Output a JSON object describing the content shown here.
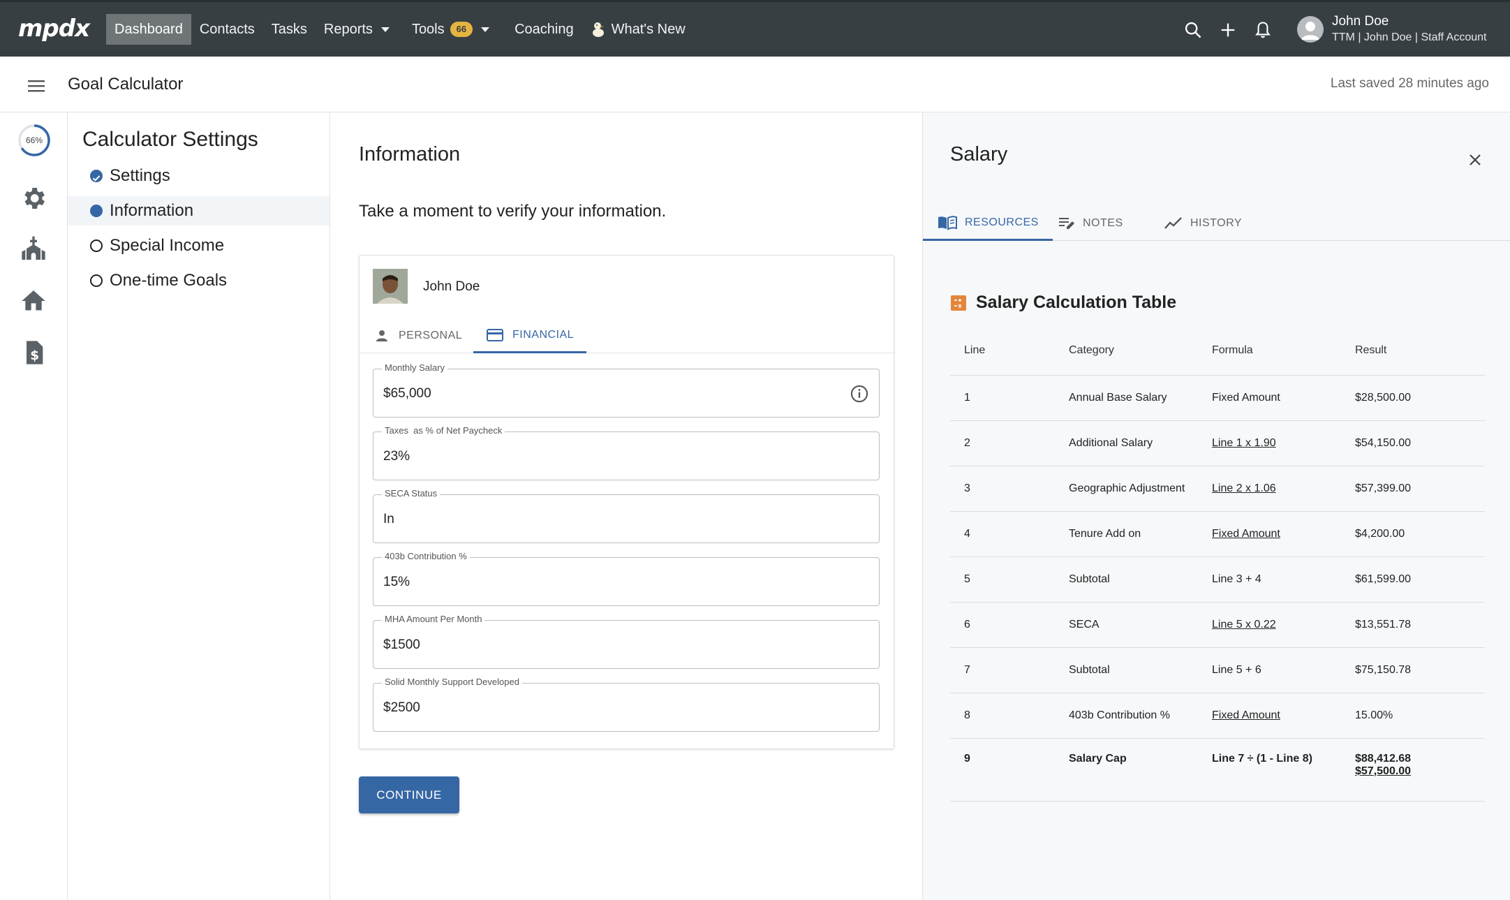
{
  "topnav": {
    "logo": "mpdx",
    "links": {
      "dashboard": "Dashboard",
      "contacts": "Contacts",
      "tasks": "Tasks",
      "reports": "Reports",
      "tools": "Tools",
      "tools_badge": "66",
      "coaching": "Coaching",
      "whats_new": "What's New"
    },
    "user": {
      "name": "John Doe",
      "account": "TTM | John Doe | Staff Account"
    }
  },
  "subheader": {
    "title": "Goal Calculator",
    "last_saved": "Last saved 28 minutes ago"
  },
  "rail": {
    "progress_label": "66%",
    "progress_value": 0.66,
    "icons": [
      "gear-icon",
      "church-icon",
      "home-icon",
      "dollar-document-icon"
    ]
  },
  "settings": {
    "title": "Calculator Settings",
    "steps": [
      {
        "label": "Settings",
        "state": "done"
      },
      {
        "label": "Information",
        "state": "current"
      },
      {
        "label": "Special Income",
        "state": "todo"
      },
      {
        "label": "One-time Goals",
        "state": "todo"
      }
    ]
  },
  "main": {
    "title": "Information",
    "lead": "Take a moment to verify your information.",
    "person_name": "John Doe",
    "tabs": {
      "personal": "PERSONAL",
      "financial": "FINANCIAL"
    },
    "fields": [
      {
        "label": "Monthly Salary",
        "value": "$65,000"
      },
      {
        "label": "Taxes  as % of Net Paycheck",
        "value": "23%"
      },
      {
        "label": "SECA Status",
        "value": "In"
      },
      {
        "label": "403b Contribution %",
        "value": "15%"
      },
      {
        "label": "MHA Amount Per Month",
        "value": "$1500"
      },
      {
        "label": "Solid Monthly Support Developed",
        "value": "$2500"
      }
    ],
    "continue_label": "CONTINUE"
  },
  "panel": {
    "title": "Salary",
    "tabs": {
      "resources": "RESOURCES",
      "notes": "NOTES",
      "history": "HISTORY"
    },
    "table_title": "Salary Calculation Table",
    "columns": {
      "line": "Line",
      "category": "Category",
      "formula": "Formula",
      "result": "Result"
    },
    "rows": [
      {
        "line": "1",
        "category": "Annual Base Salary",
        "formula": "Fixed Amount",
        "result": "$28,500.00"
      },
      {
        "line": "2",
        "category": "Additional Salary",
        "formula": "Line 1 x 1.90",
        "result": "$54,150.00"
      },
      {
        "line": "3",
        "category": "Geographic Adjustment",
        "formula": "Line 2 x 1.06",
        "result": "$57,399.00"
      },
      {
        "line": "4",
        "category": "Tenure Add on",
        "formula": "Fixed Amount",
        "result": "$4,200.00"
      },
      {
        "line": "5",
        "category": "Subtotal",
        "formula": "Line 3 + 4",
        "result": "$61,599.00"
      },
      {
        "line": "6",
        "category": "SECA",
        "formula": "Line 5 x 0.22",
        "result": "$13,551.78"
      },
      {
        "line": "7",
        "category": "Subtotal",
        "formula": "Line 5 + 6",
        "result": "$75,150.78"
      },
      {
        "line": "8",
        "category": "403b Contribution %",
        "formula": "Fixed Amount",
        "result": "15.00%"
      }
    ],
    "total": {
      "line": "9",
      "category": "Salary Cap",
      "formula": "Line 7 ÷ (1 - Line 8)",
      "result": "$88,412.68",
      "result_capped": "$57,500.00"
    }
  },
  "colors": {
    "nav_bg": "#383f43",
    "accent": "#3667a5",
    "badge": "#e5b440",
    "panel_bg": "#f6f8fa"
  }
}
